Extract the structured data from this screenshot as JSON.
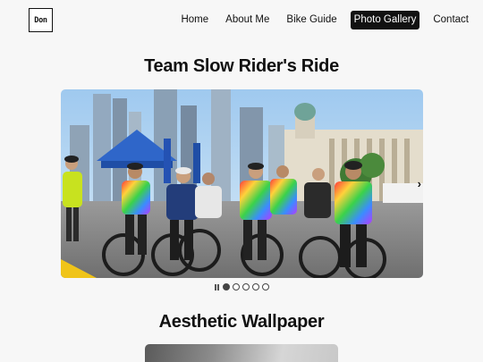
{
  "logo": {
    "text": "Don"
  },
  "nav": {
    "items": [
      {
        "label": "Home",
        "active": false
      },
      {
        "label": "About Me",
        "active": false
      },
      {
        "label": "Bike Guide",
        "active": false
      },
      {
        "label": "Photo Gallery",
        "active": true
      },
      {
        "label": "Contact",
        "active": false
      }
    ]
  },
  "gallery": {
    "title": "Team Slow Rider's Ride",
    "slide_count": 5,
    "current_slide": 1
  },
  "wallpaper": {
    "title": "Aesthetic Wallpaper"
  },
  "colors": {
    "accent": "#111111",
    "background": "#f7f7f7"
  }
}
